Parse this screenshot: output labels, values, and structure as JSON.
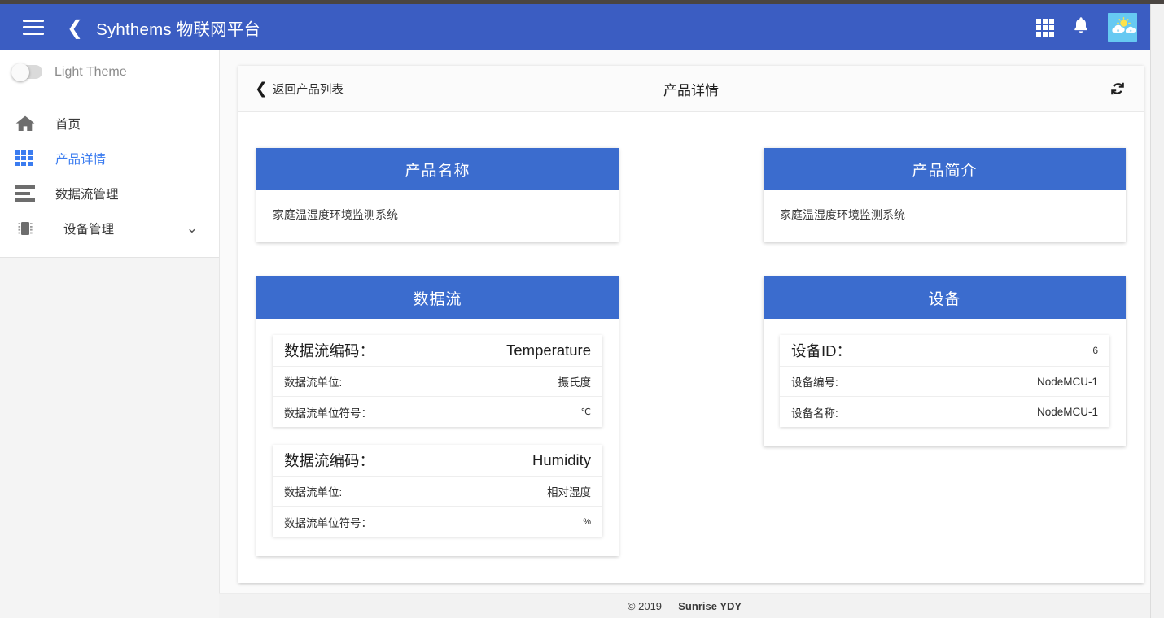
{
  "appbar": {
    "menu_icon": "hamburger-icon",
    "back_icon": "chevron-left-icon",
    "brand": "Syhthems 物联网平台",
    "apps_icon": "grid-apps-icon",
    "bell_icon": "bell-icon",
    "avatar_icon": "weather-avatar"
  },
  "sidebar": {
    "theme_toggle_label": "Light Theme",
    "items": [
      {
        "label": "首页",
        "icon": "home-icon",
        "active": false,
        "expandable": false
      },
      {
        "label": "产品详情",
        "icon": "grid-icon",
        "active": true,
        "expandable": false
      },
      {
        "label": "数据流管理",
        "icon": "streams-icon",
        "active": false,
        "expandable": false
      },
      {
        "label": "设备管理",
        "icon": "chip-icon",
        "active": false,
        "expandable": true
      }
    ],
    "chevron_icon": "chevron-down-icon"
  },
  "panel": {
    "back_label": "返回产品列表",
    "back_icon": "chevron-left-icon",
    "title": "产品详情",
    "refresh_icon": "refresh-icon"
  },
  "cards": {
    "product_name": {
      "title": "产品名称",
      "value": "家庭温湿度环境监测系统"
    },
    "product_intro": {
      "title": "产品简介",
      "value": "家庭温湿度环境监测系统"
    },
    "datastream": {
      "title": "数据流",
      "groups": [
        {
          "rows": [
            {
              "key": "数据流编码：",
              "value": "Temperature",
              "emphasis": true
            },
            {
              "key": "数据流单位:",
              "value": "摄氏度",
              "emphasis": false
            },
            {
              "key": "数据流单位符号：",
              "value": "℃",
              "emphasis": false,
              "tiny": true
            }
          ]
        },
        {
          "rows": [
            {
              "key": "数据流编码：",
              "value": "Humidity",
              "emphasis": true
            },
            {
              "key": "数据流单位:",
              "value": "相对湿度",
              "emphasis": false
            },
            {
              "key": "数据流单位符号：",
              "value": "%",
              "emphasis": false,
              "tiny": true
            }
          ]
        }
      ]
    },
    "device": {
      "title": "设备",
      "groups": [
        {
          "rows": [
            {
              "key": "设备ID：",
              "value": "6",
              "emphasis": true,
              "value_small": true
            },
            {
              "key": "设备编号:",
              "value": "NodeMCU-1",
              "emphasis": false
            },
            {
              "key": "设备名称:",
              "value": "NodeMCU-1",
              "emphasis": false
            }
          ]
        }
      ]
    }
  },
  "footer": {
    "copyright": "© 2019 — ",
    "brand": "Sunrise YDY"
  },
  "colors": {
    "appbar": "#3b5dc2",
    "card_header": "#3b6cce",
    "accent": "#3b7cf0",
    "topstrip": "#4a4541"
  }
}
